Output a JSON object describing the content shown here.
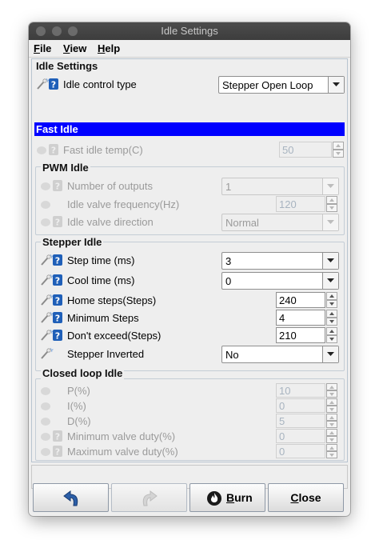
{
  "window": {
    "title": "Idle Settings"
  },
  "menu": [
    {
      "key": "F",
      "rest": "ile"
    },
    {
      "key": "V",
      "rest": "iew"
    },
    {
      "key": "H",
      "rest": "elp"
    }
  ],
  "idle_settings": {
    "title": "Idle Settings",
    "control_type_label": "Idle control type",
    "control_type_value": "Stepper Open Loop",
    "fast_idle_header": "Fast Idle",
    "fast_idle_temp_label": "Fast idle temp(C)",
    "fast_idle_temp_value": "50"
  },
  "pwm_idle": {
    "title": "PWM Idle",
    "outputs_label": "Number of outputs",
    "outputs_value": "1",
    "freq_label": "Idle valve frequency(Hz)",
    "freq_value": "120",
    "direction_label": "Idle valve direction",
    "direction_value": "Normal"
  },
  "stepper_idle": {
    "title": "Stepper Idle",
    "step_time_label": "Step time (ms)",
    "step_time_value": "3",
    "cool_time_label": "Cool time (ms)",
    "cool_time_value": "0",
    "home_steps_label": "Home steps(Steps)",
    "home_steps_value": "240",
    "min_steps_label": "Minimum Steps",
    "min_steps_value": "4",
    "dont_exceed_label": "Don't exceed(Steps)",
    "dont_exceed_value": "210",
    "inverted_label": "Stepper Inverted",
    "inverted_value": "No"
  },
  "closed_loop": {
    "title": "Closed loop Idle",
    "p_label": "P(%)",
    "p_value": "10",
    "i_label": "I(%)",
    "i_value": "0",
    "d_label": "D(%)",
    "d_value": "5",
    "min_duty_label": "Minimum valve duty(%)",
    "min_duty_value": "0",
    "max_duty_label": "Maximum valve duty(%)",
    "max_duty_value": "0"
  },
  "buttons": {
    "burn_key": "B",
    "burn_rest": "urn",
    "close_key": "C",
    "close_rest": "lose"
  },
  "colors": {
    "fast_idle_bg": "#0000ff",
    "help_icon": "#1f5fb8",
    "undo_icon": "#2c5fa8"
  }
}
